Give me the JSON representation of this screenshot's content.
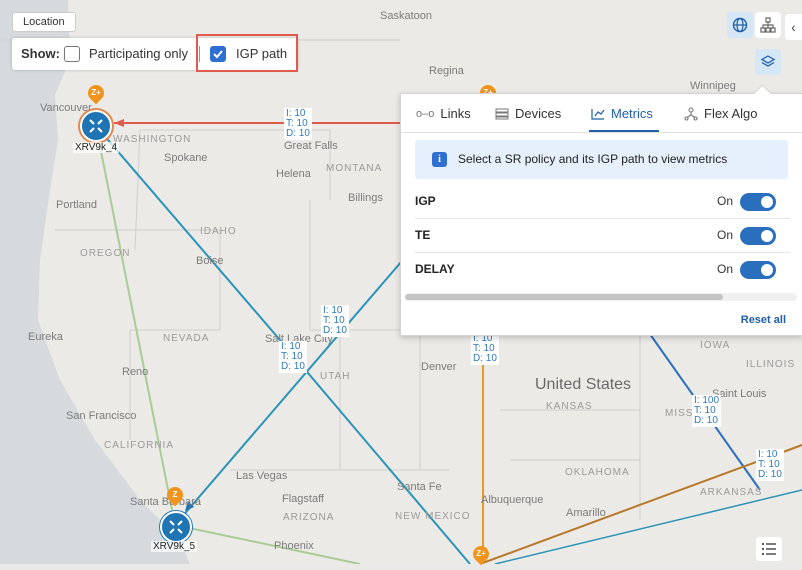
{
  "location_button": "Location",
  "show_bar": {
    "label": "Show:",
    "participating_only": {
      "label": "Participating only",
      "checked": false
    },
    "igp_path": {
      "label": "IGP path",
      "checked": true
    }
  },
  "map_labels": {
    "cities": [
      "Saskatoon",
      "Regina",
      "Winnipeg",
      "Vancouver",
      "Spokane",
      "Great Falls",
      "Helena",
      "Billings",
      "Portland",
      "Boise",
      "Salt Lake City",
      "Reno",
      "Denver",
      "San Francisco",
      "Las Vegas",
      "Flagstaff",
      "Santa Fe",
      "Albuquerque",
      "Amarillo",
      "Phoenix",
      "Santa Barbara",
      "Saint Louis",
      "Eureka"
    ],
    "states": [
      "WASHINGTON",
      "MONTANA",
      "IDAHO",
      "OREGON",
      "NEVADA",
      "UTAH",
      "CALIFORNIA",
      "ARIZONA",
      "NEW MEXICO",
      "KANSAS",
      "OKLAHOMA",
      "ARKANSAS",
      "MISSOURI",
      "ILLINOIS",
      "IOWA"
    ],
    "country": "United States"
  },
  "nodes": [
    {
      "name": "XRV9k_4",
      "pin": "Z+"
    },
    {
      "name": "XRV9k_5",
      "pin": "Z"
    }
  ],
  "pins": [
    "Z+",
    "Z+"
  ],
  "link_labels": [
    {
      "i": "I: 10",
      "t": "T: 10",
      "d": "D: 10"
    },
    {
      "i": "I: 10",
      "t": "T: 10",
      "d": "D: 10"
    },
    {
      "i": "I: 10",
      "t": "T: 10",
      "d": "D: 10"
    },
    {
      "i": "I: 10",
      "t": "T: 10",
      "d": "D: 10"
    },
    {
      "i": "I: 100",
      "t": "T: 10",
      "d": "D: 10"
    },
    {
      "i": "I: 10",
      "t": "T: 10",
      "d": "D: 10"
    }
  ],
  "panel": {
    "tabs": [
      {
        "label": "Links",
        "icon": "link-icon"
      },
      {
        "label": "Devices",
        "icon": "devices-icon"
      },
      {
        "label": "Metrics",
        "icon": "metrics-icon",
        "active": true
      },
      {
        "label": "Flex Algo",
        "icon": "flex-algo-icon"
      }
    ],
    "info_message": "Select a SR policy and its IGP path to view metrics",
    "metrics": [
      {
        "name": "IGP",
        "state": "On",
        "enabled": true
      },
      {
        "name": "TE",
        "state": "On",
        "enabled": true
      },
      {
        "name": "DELAY",
        "state": "On",
        "enabled": true
      }
    ],
    "reset_label": "Reset all"
  },
  "colors": {
    "node": "#1f74b4",
    "igp_path": "#e05a4e",
    "link_teal": "#2a93b8",
    "link_orange": "#e79a2a",
    "link_green": "#a9cc96",
    "accent": "#1f5fa8"
  }
}
